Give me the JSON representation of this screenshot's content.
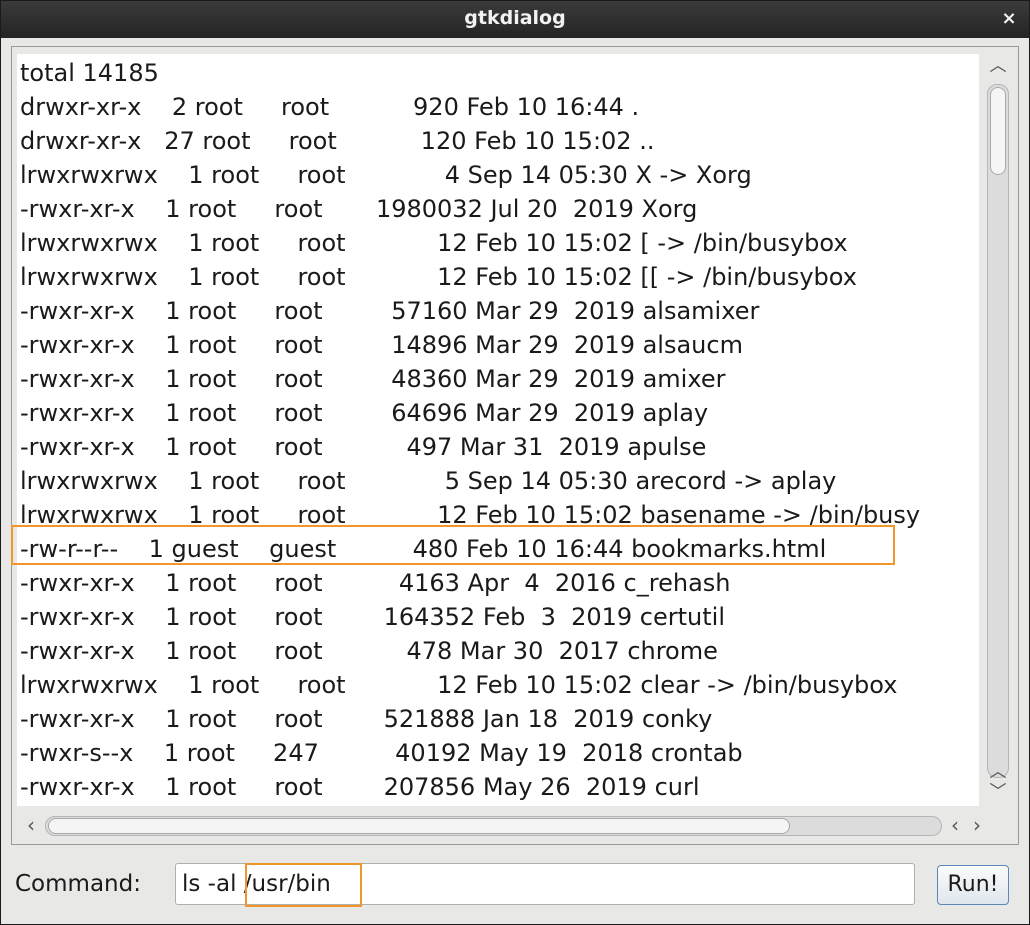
{
  "window": {
    "title": "gtkdialog",
    "close_glyph": "×"
  },
  "listing": {
    "lines": [
      "total 14185",
      "drwxr-xr-x    2 root     root           920 Feb 10 16:44 .",
      "drwxr-xr-x   27 root     root           120 Feb 10 15:02 ..",
      "lrwxrwxrwx    1 root     root             4 Sep 14 05:30 X -> Xorg",
      "-rwxr-xr-x    1 root     root       1980032 Jul 20  2019 Xorg",
      "lrwxrwxrwx    1 root     root            12 Feb 10 15:02 [ -> /bin/busybox",
      "lrwxrwxrwx    1 root     root            12 Feb 10 15:02 [[ -> /bin/busybox",
      "-rwxr-xr-x    1 root     root         57160 Mar 29  2019 alsamixer",
      "-rwxr-xr-x    1 root     root         14896 Mar 29  2019 alsaucm",
      "-rwxr-xr-x    1 root     root         48360 Mar 29  2019 amixer",
      "-rwxr-xr-x    1 root     root         64696 Mar 29  2019 aplay",
      "-rwxr-xr-x    1 root     root           497 Mar 31  2019 apulse",
      "lrwxrwxrwx    1 root     root             5 Sep 14 05:30 arecord -> aplay",
      "lrwxrwxrwx    1 root     root            12 Feb 10 15:02 basename -> /bin/busy",
      "-rw-r--r--    1 guest    guest          480 Feb 10 16:44 bookmarks.html",
      "-rwxr-xr-x    1 root     root          4163 Apr  4  2016 c_rehash",
      "-rwxr-xr-x    1 root     root        164352 Feb  3  2019 certutil",
      "-rwxr-xr-x    1 root     root           478 Mar 30  2017 chrome",
      "lrwxrwxrwx    1 root     root            12 Feb 10 15:02 clear -> /bin/busybox",
      "-rwxr-xr-x    1 root     root        521888 Jan 18  2019 conky",
      "-rwxr-s--x    1 root     247          40192 May 19  2018 crontab",
      "-rwxr-xr-x    1 root     root        207856 May 26  2019 curl"
    ]
  },
  "scrollbar": {
    "up_glyph": "︿",
    "down_glyph": "﹀",
    "left_glyph": "‹",
    "right_glyph": "›"
  },
  "command": {
    "label": "Command:",
    "value": "ls -al /usr/bin",
    "run_label": "Run!"
  },
  "colors": {
    "highlight": "#f0962a",
    "titlebar": "#2b2b2b"
  }
}
